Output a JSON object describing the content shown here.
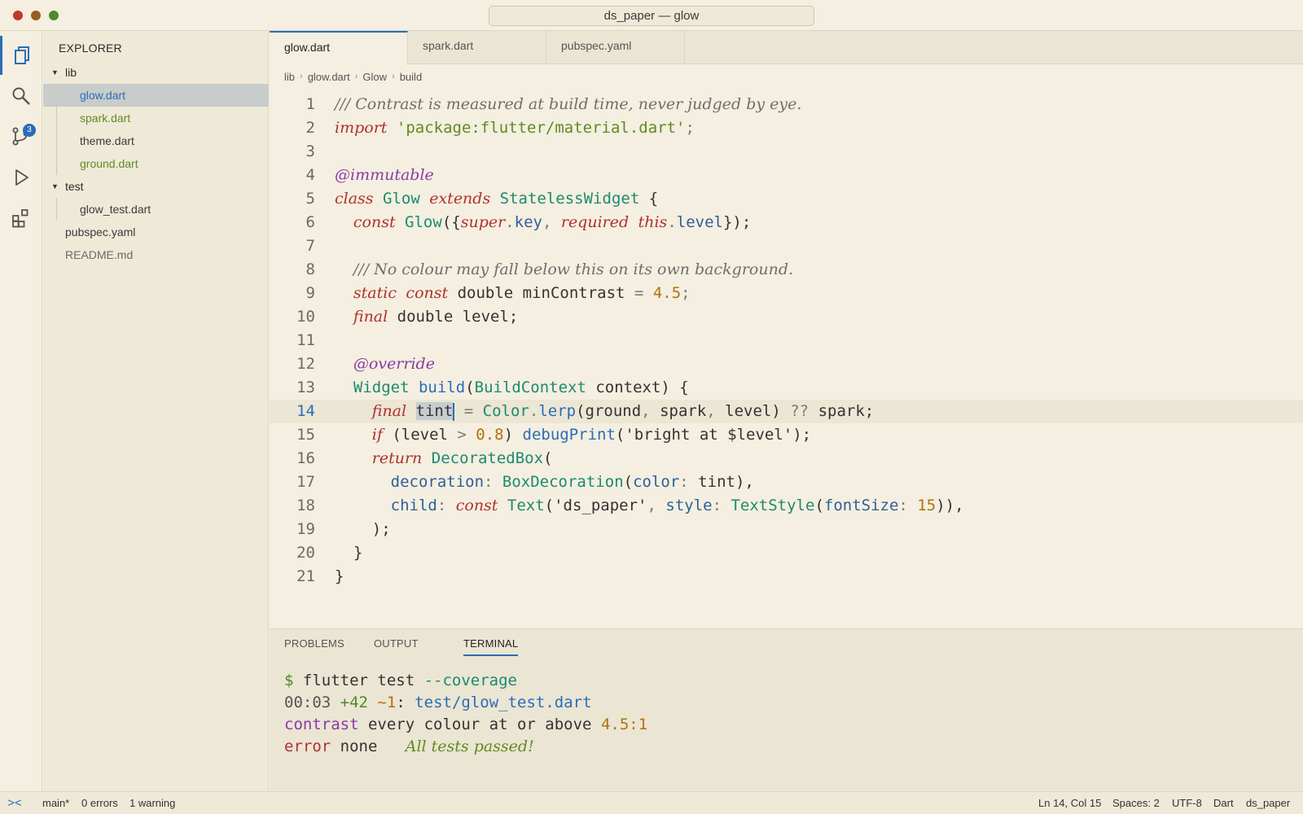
{
  "window": {
    "title": "ds_paper — glow"
  },
  "activity_bar": {
    "items": [
      {
        "name": "explorer",
        "icon": "files-icon",
        "active": true
      },
      {
        "name": "search",
        "icon": "search-icon"
      },
      {
        "name": "source-control",
        "icon": "source-control-icon",
        "badge": "3"
      },
      {
        "name": "run",
        "icon": "run-icon"
      },
      {
        "name": "extensions",
        "icon": "extensions-icon"
      }
    ]
  },
  "sidebar": {
    "title": "EXPLORER",
    "tree": [
      {
        "label": "lib",
        "type": "folder",
        "expanded": true
      },
      {
        "label": "glow.dart",
        "type": "file",
        "color": "#2a6db8",
        "selected": true
      },
      {
        "label": "spark.dart",
        "type": "file",
        "color": "#5f8a22"
      },
      {
        "label": "theme.dart",
        "type": "file",
        "color": "#3a3a3a"
      },
      {
        "label": "ground.dart",
        "type": "file",
        "color": "#5f8a22"
      },
      {
        "label": "test",
        "type": "folder",
        "expanded": true
      },
      {
        "label": "glow_test.dart",
        "type": "file",
        "color": "#3a3a3a"
      },
      {
        "label": "pubspec.yaml",
        "type": "file",
        "color": "#3a3a3a"
      },
      {
        "label": "README.md",
        "type": "file",
        "color": "#6a6a6a"
      }
    ]
  },
  "tabs": [
    {
      "label": "glow.dart",
      "active": true
    },
    {
      "label": "spark.dart"
    },
    {
      "label": "pubspec.yaml"
    }
  ],
  "breadcrumb": [
    "lib",
    "glow.dart",
    "Glow",
    "build"
  ],
  "editor": {
    "current_line": 14,
    "lines": [
      {
        "n": "1",
        "tokens": [
          [
            "c-comment",
            "/// Contrast is measured at build time, never judged by eye."
          ]
        ]
      },
      {
        "n": "2",
        "tokens": [
          [
            "c-kw",
            "import"
          ],
          [
            "",
            " "
          ],
          [
            "c-str",
            "'package:flutter/material.dart'"
          ],
          [
            "c-punc",
            ";"
          ]
        ]
      },
      {
        "n": "3",
        "tokens": []
      },
      {
        "n": "4",
        "tokens": [
          [
            "c-anno",
            "@immutable"
          ]
        ]
      },
      {
        "n": "5",
        "tokens": [
          [
            "c-kw",
            "class"
          ],
          [
            "",
            " "
          ],
          [
            "c-type",
            "Glow"
          ],
          [
            "",
            " "
          ],
          [
            "c-kw",
            "extends"
          ],
          [
            "",
            " "
          ],
          [
            "c-type",
            "StatelessWidget"
          ],
          [
            "",
            " {"
          ]
        ]
      },
      {
        "n": "6",
        "tokens": [
          [
            "",
            "  "
          ],
          [
            "c-kw",
            "const"
          ],
          [
            "",
            " "
          ],
          [
            "c-type",
            "Glow"
          ],
          [
            "",
            "({"
          ],
          [
            "c-kw",
            "super"
          ],
          [
            "c-punc",
            "."
          ],
          [
            "c-prop",
            "key"
          ],
          [
            "c-punc",
            ", "
          ],
          [
            "c-kw",
            "required"
          ],
          [
            "",
            " "
          ],
          [
            "c-kw",
            "this"
          ],
          [
            "c-punc",
            "."
          ],
          [
            "c-prop",
            "level"
          ],
          [
            "",
            "});"
          ]
        ]
      },
      {
        "n": "7",
        "tokens": []
      },
      {
        "n": "8",
        "tokens": [
          [
            "",
            "  "
          ],
          [
            "c-comment",
            "/// No colour may fall below this on its own background."
          ]
        ]
      },
      {
        "n": "9",
        "tokens": [
          [
            "",
            "  "
          ],
          [
            "c-kw",
            "static"
          ],
          [
            "",
            " "
          ],
          [
            "c-kw",
            "const"
          ],
          [
            "",
            " double minContrast "
          ],
          [
            "c-punc",
            "="
          ],
          [
            "",
            " "
          ],
          [
            "c-num",
            "4.5"
          ],
          [
            "c-punc",
            ";"
          ]
        ]
      },
      {
        "n": "10",
        "tokens": [
          [
            "",
            "  "
          ],
          [
            "c-kw",
            "final"
          ],
          [
            "",
            " double level;"
          ]
        ]
      },
      {
        "n": "11",
        "tokens": []
      },
      {
        "n": "12",
        "tokens": [
          [
            "",
            "  "
          ],
          [
            "c-anno",
            "@override"
          ]
        ]
      },
      {
        "n": "13",
        "tokens": [
          [
            "",
            "  "
          ],
          [
            "c-type",
            "Widget"
          ],
          [
            "",
            " "
          ],
          [
            "c-fn",
            "build"
          ],
          [
            "",
            "("
          ],
          [
            "c-type",
            "BuildContext"
          ],
          [
            "",
            " context) {"
          ]
        ]
      },
      {
        "n": "14",
        "tokens": [
          [
            "",
            "    "
          ],
          [
            "c-kw",
            "final"
          ],
          [
            "",
            " "
          ],
          [
            "sel",
            "tint"
          ],
          [
            "cursor",
            ""
          ],
          [
            "",
            " "
          ],
          [
            "c-punc",
            "="
          ],
          [
            "",
            " "
          ],
          [
            "c-type",
            "Color"
          ],
          [
            "c-punc",
            "."
          ],
          [
            "c-fn",
            "lerp"
          ],
          [
            "",
            "(ground"
          ],
          [
            "c-punc",
            ", "
          ],
          [
            "",
            "spark"
          ],
          [
            "c-punc",
            ", "
          ],
          [
            "",
            "level) "
          ],
          [
            "c-punc",
            "??"
          ],
          [
            "",
            " spark;"
          ]
        ]
      },
      {
        "n": "15",
        "tokens": [
          [
            "",
            "    "
          ],
          [
            "c-kw",
            "if"
          ],
          [
            "",
            " (level "
          ],
          [
            "c-punc",
            ">"
          ],
          [
            "",
            " "
          ],
          [
            "c-num",
            "0.8"
          ],
          [
            "",
            ") "
          ],
          [
            "c-fn",
            "debugPrint"
          ],
          [
            "",
            "('bright at $level');"
          ]
        ]
      },
      {
        "n": "16",
        "tokens": [
          [
            "",
            "    "
          ],
          [
            "c-kw",
            "return"
          ],
          [
            "",
            " "
          ],
          [
            "c-type",
            "DecoratedBox"
          ],
          [
            "",
            "("
          ]
        ]
      },
      {
        "n": "17",
        "tokens": [
          [
            "",
            "      "
          ],
          [
            "c-prop",
            "decoration"
          ],
          [
            "c-punc",
            ": "
          ],
          [
            "c-type",
            "BoxDecoration"
          ],
          [
            "",
            "("
          ],
          [
            "c-prop",
            "color"
          ],
          [
            "c-punc",
            ": "
          ],
          [
            "",
            "tint),"
          ]
        ]
      },
      {
        "n": "18",
        "tokens": [
          [
            "",
            "      "
          ],
          [
            "c-prop",
            "child"
          ],
          [
            "c-punc",
            ": "
          ],
          [
            "c-kw",
            "const"
          ],
          [
            "",
            " "
          ],
          [
            "c-type",
            "Text"
          ],
          [
            "",
            "('ds_paper'"
          ],
          [
            "c-punc",
            ", "
          ],
          [
            "c-prop",
            "style"
          ],
          [
            "c-punc",
            ": "
          ],
          [
            "c-type",
            "TextStyle"
          ],
          [
            "",
            "("
          ],
          [
            "c-prop",
            "fontSize"
          ],
          [
            "c-punc",
            ": "
          ],
          [
            "c-num",
            "15"
          ],
          [
            "",
            ")),"
          ]
        ]
      },
      {
        "n": "19",
        "tokens": [
          [
            "",
            "    );"
          ]
        ]
      },
      {
        "n": "20",
        "tokens": [
          [
            "",
            "  }"
          ]
        ]
      },
      {
        "n": "21",
        "tokens": [
          [
            "",
            "}"
          ]
        ]
      }
    ]
  },
  "panel": {
    "tabs": [
      {
        "label": "PROBLEMS"
      },
      {
        "label": "OUTPUT"
      },
      {
        "label": "TERMINAL",
        "active": true
      }
    ],
    "terminal": [
      [
        [
          "t-green",
          "$"
        ],
        [
          "",
          " flutter test "
        ],
        [
          "t-teal",
          "--coverage"
        ]
      ],
      [
        [
          "t-grey",
          "00:03 "
        ],
        [
          "t-green",
          "+42"
        ],
        [
          "",
          " "
        ],
        [
          "t-gold",
          "~1"
        ],
        [
          "",
          ": "
        ],
        [
          "t-blue",
          "test/glow_test.dart"
        ]
      ],
      [
        [
          "t-purple",
          "contrast"
        ],
        [
          "",
          " every colour at or above "
        ],
        [
          "t-gold",
          "4.5:1"
        ]
      ],
      [
        [
          "t-red",
          "error"
        ],
        [
          "",
          " none   "
        ],
        [
          "t-ok",
          "All tests passed!"
        ]
      ]
    ]
  },
  "status_bar": {
    "remote_icon": "><",
    "branch": "main*",
    "errors": "0 errors",
    "warnings": "1 warning",
    "position": "Ln 14, Col 15",
    "spaces": "Spaces: 2",
    "encoding": "UTF-8",
    "language": "Dart",
    "project": "ds_paper"
  }
}
